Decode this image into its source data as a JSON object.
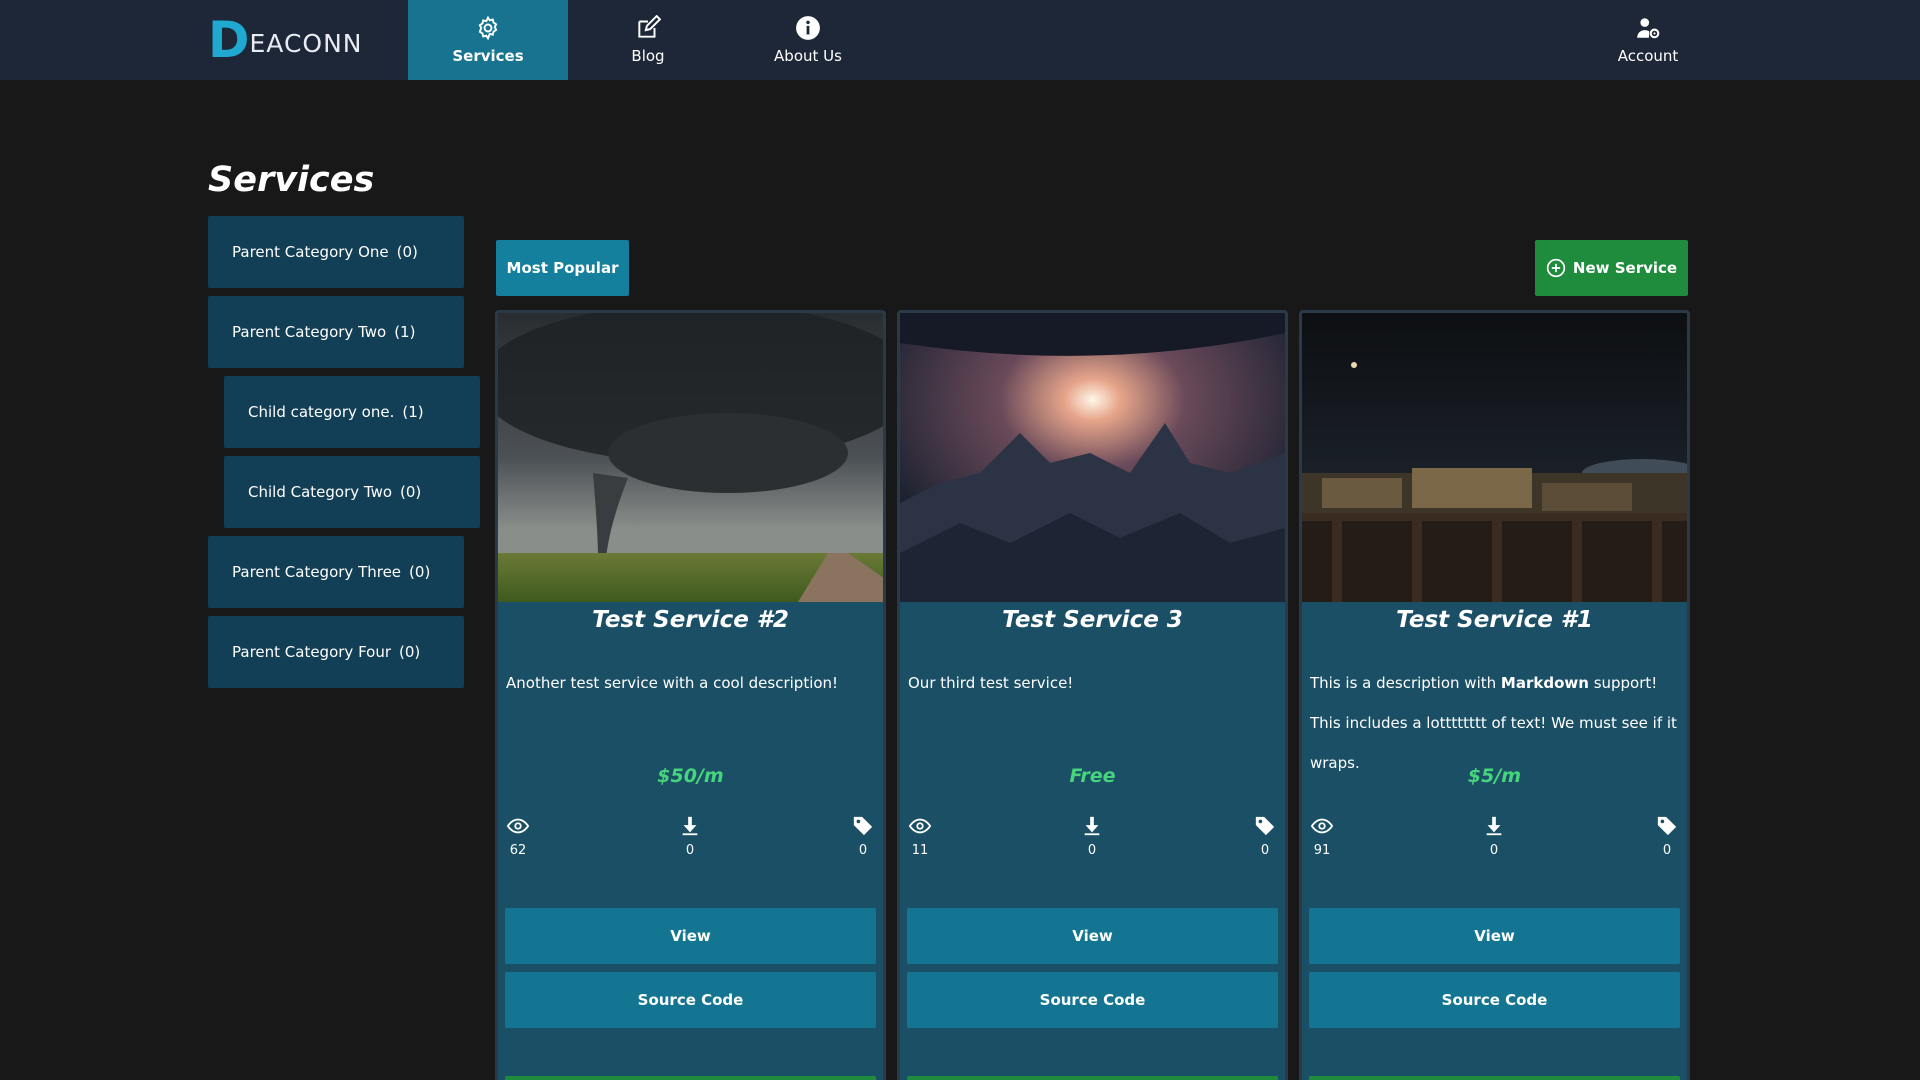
{
  "brand": {
    "logo_letter": "D",
    "logo_text": "EACONN",
    "accent": "#1fa8d0"
  },
  "nav": {
    "services": {
      "label": "Services",
      "icon": "gear-icon"
    },
    "blog": {
      "label": "Blog",
      "icon": "edit-icon"
    },
    "about": {
      "label": "About Us",
      "icon": "info-icon"
    },
    "account": {
      "label": "Account",
      "icon": "user-gear-icon"
    }
  },
  "page": {
    "title": "Services"
  },
  "sidebar": {
    "items": [
      {
        "label": "Parent Category One",
        "count": "(0)",
        "level": "parent"
      },
      {
        "label": "Parent Category Two",
        "count": "(1)",
        "level": "parent"
      },
      {
        "label": "Child category one.",
        "count": "(1)",
        "level": "child"
      },
      {
        "label": "Child Category Two",
        "count": "(0)",
        "level": "child"
      },
      {
        "label": "Parent Category Three",
        "count": "(0)",
        "level": "parent"
      },
      {
        "label": "Parent Category Four",
        "count": "(0)",
        "level": "parent"
      }
    ]
  },
  "toolbar": {
    "most_popular_label": "Most Popular",
    "new_service_label": "New Service",
    "new_service_color": "#1e8c3c"
  },
  "cards": [
    {
      "title": "Test Service #2",
      "description": "Another test service with a cool description!",
      "price": "$50/m",
      "views": "62",
      "downloads": "0",
      "tags": "0",
      "view_label": "View",
      "source_label": "Source Code"
    },
    {
      "title": "Test Service 3",
      "description": "Our third test service!",
      "price": "Free",
      "views": "11",
      "downloads": "0",
      "tags": "0",
      "view_label": "View",
      "source_label": "Source Code"
    },
    {
      "title": "Test Service #1",
      "description_parts": {
        "before": "This is a description with ",
        "bold": "Markdown",
        "after": " support! This includes a lotttttttt of text! We must see if it wraps."
      },
      "price": "$5/m",
      "views": "91",
      "downloads": "0",
      "tags": "0",
      "view_label": "View",
      "source_label": "Source Code"
    }
  ],
  "colors": {
    "price": "#46d47c",
    "card_bg": "#1a4f66",
    "button": "#137591",
    "nav_active": "#17738f"
  }
}
